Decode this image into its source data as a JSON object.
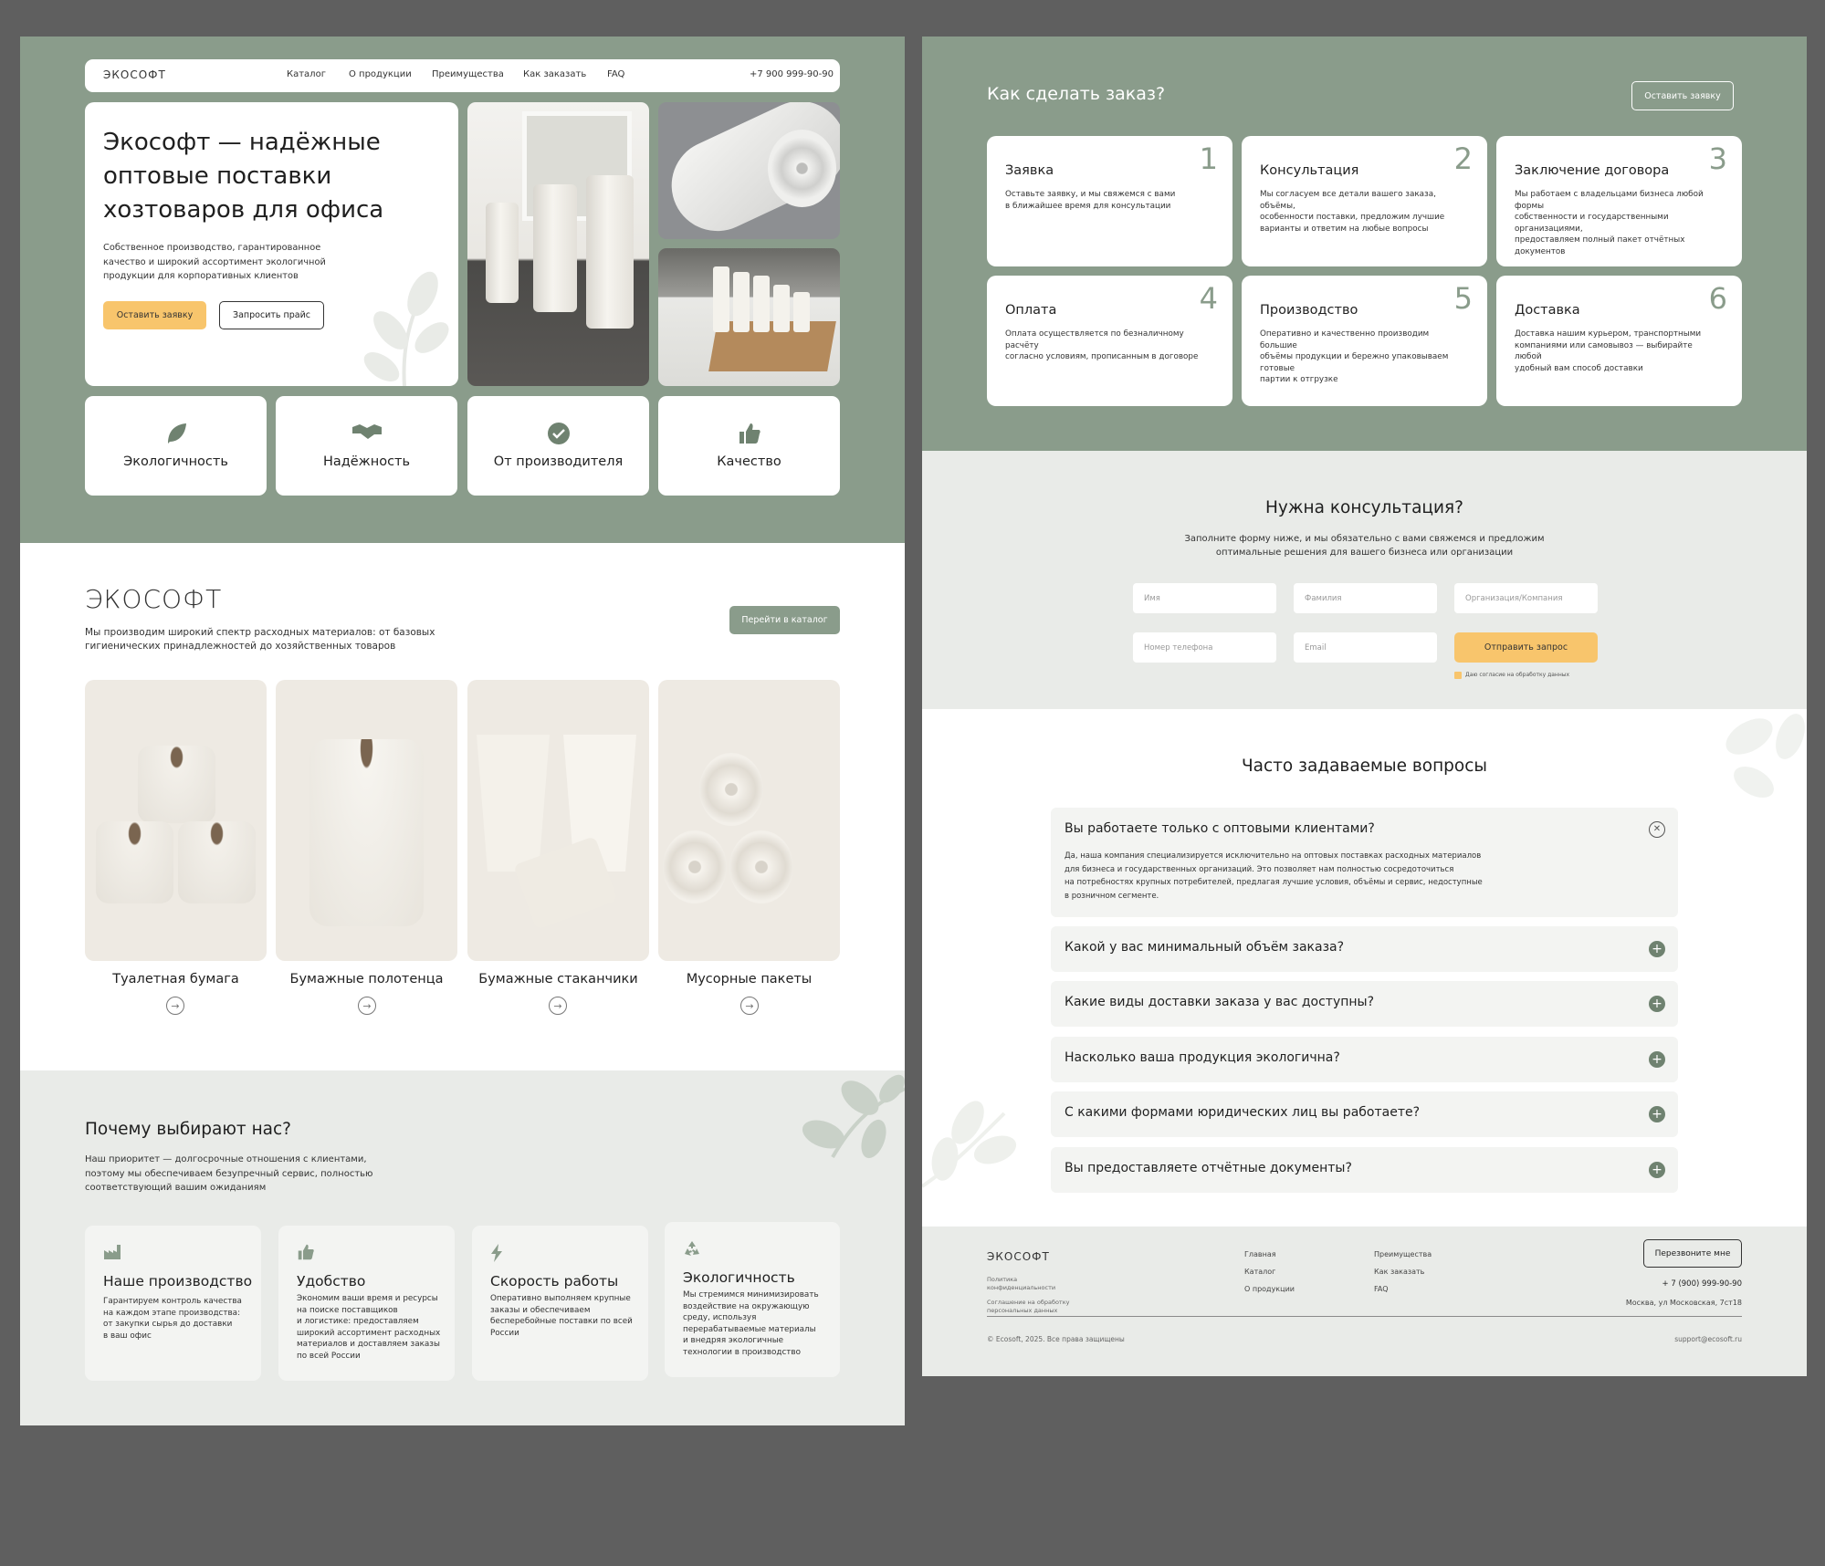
{
  "left": {
    "nav": {
      "logo": "ЭКОСОФТ",
      "links": [
        "Каталог",
        "О продукции",
        "Преимущества",
        "Как заказать",
        "FAQ"
      ],
      "phone": "+7 900 999-90-90"
    },
    "hero": {
      "title_line1": "Экософт — надёжные",
      "title_line2": "оптовые поставки",
      "title_line3": "хозтоваров для офиса",
      "desc_line1": "Собственное производство, гарантированное",
      "desc_line2": "качество и широкий ассортимент экологичной",
      "desc_line3": "продукции для корпоративных клиентов",
      "btn_primary": "Оставить заявку",
      "btn_secondary": "Запросить прайс"
    },
    "features": [
      "Экологичность",
      "Надёжность",
      "От производителя",
      "Качество"
    ],
    "catalog": {
      "logo": "ЭКОСОФТ",
      "desc_line1": "Мы производим широкий спектр расходных материалов: от базовых",
      "desc_line2": "гигиенических принадлежностей до хозяйственных товаров",
      "button": "Перейти в каталог",
      "products": [
        "Туалетная бумага",
        "Бумажные полотенца",
        "Бумажные стаканчики",
        "Мусорные пакеты"
      ]
    },
    "why": {
      "title": "Почему выбирают нас?",
      "desc_line1": "Наш приоритет — долгосрочные отношения с клиентами,",
      "desc_line2": "поэтому мы обеспечиваем безупречный сервис, полностью",
      "desc_line3": "соответствующий вашим ожиданиям",
      "cards": [
        {
          "title": "Наше производство",
          "lines": [
            "Гарантируем контроль качества",
            "на каждом этапе производства:",
            "от закупки сырья до доставки",
            "в ваш офис"
          ]
        },
        {
          "title": "Удобство",
          "lines": [
            "Экономим ваши время и ресурсы",
            "на поиске поставщиков",
            "и логистике: предоставляем",
            "широкий ассортимент расходных",
            "материалов и доставляем заказы",
            "по всей России"
          ]
        },
        {
          "title": "Скорость работы",
          "lines": [
            "Оперативно выполняем крупные",
            "заказы и обеспечиваем",
            "бесперебойные поставки по всей",
            "России"
          ]
        },
        {
          "title": "Экологичность",
          "lines": [
            "Мы стремимся минимизировать",
            "воздействие на окружающую",
            "среду, используя",
            "перерабатываемые материалы",
            "и внедряя экологичные",
            "технологии в производство"
          ]
        }
      ]
    }
  },
  "right": {
    "order": {
      "title": "Как сделать заказ?",
      "button": "Оставить заявку",
      "steps": [
        {
          "num": "1",
          "title": "Заявка",
          "lines": [
            "Оставьте заявку, и мы свяжемся с вами",
            "в ближайшее время для консультации"
          ]
        },
        {
          "num": "2",
          "title": "Консультация",
          "lines": [
            "Мы согласуем все детали вашего заказа, объёмы,",
            "особенности поставки, предложим лучшие",
            "варианты и ответим на любые вопросы"
          ]
        },
        {
          "num": "3",
          "title": "Заключение договора",
          "lines": [
            "Мы работаем с владельцами бизнеса любой формы",
            "собственности и государственными организациями,",
            "предоставляем полный пакет отчётных документов"
          ]
        },
        {
          "num": "4",
          "title": "Оплата",
          "lines": [
            "Оплата осуществляется по безналичному расчёту",
            "согласно условиям, прописанным в договоре"
          ]
        },
        {
          "num": "5",
          "title": "Производство",
          "lines": [
            "Оперативно и качественно производим большие",
            "объёмы продукции и бережно упаковываем готовые",
            "партии к отгрузке"
          ]
        },
        {
          "num": "6",
          "title": "Доставка",
          "lines": [
            "Доставка нашим курьером, транспортными",
            "компаниями или самовывоз — выбирайте любой",
            "удобный вам способ доставки"
          ]
        }
      ]
    },
    "consult": {
      "title": "Нужна консультация?",
      "desc_line1": "Заполните форму ниже, и мы обязательно с вами свяжемся и предложим",
      "desc_line2": "оптимальные решения для вашего бизнеса или организации",
      "ph_name": "Имя",
      "ph_surname": "Фамилия",
      "ph_org": "Организация/Компания",
      "ph_phone": "Номер телефона",
      "ph_email": "Email",
      "submit": "Отправить запрос",
      "consent": "Даю согласие на обработку данных"
    },
    "faq": {
      "title": "Часто задаваемые вопросы",
      "open_q": "Вы работаете только с оптовыми клиентами?",
      "open_a": [
        "Да, наша компания специализируется исключительно на оптовых поставках расходных материалов",
        "для бизнеса и государственных организаций. Это позволяет нам полностью сосредоточиться",
        "на потребностях крупных потребителей, предлагая лучшие условия, объёмы и сервис, недоступные",
        "в розничном сегменте."
      ],
      "items": [
        "Какой у вас минимальный объём заказа?",
        "Какие виды доставки заказа у вас доступны?",
        "Насколько ваша продукция экологична?",
        "С какими формами юридических лиц вы работаете?",
        "Вы предоставляете отчётные документы?"
      ]
    },
    "footer": {
      "logo": "ЭКОСОФТ",
      "policy1": "Политика",
      "policy2": "конфиденциальности",
      "agree1": "Соглашение на обработку",
      "agree2": "персональных данных",
      "col1": [
        "Главная",
        "Каталог",
        "О продукции"
      ],
      "col2": [
        "Преимущества",
        "Как заказать",
        "FAQ"
      ],
      "callback": "Перезвоните мне",
      "phone": "+ 7 (900) 999-90-90",
      "address": "Москва, ул Московская, 7ст18",
      "copyright": "© Ecosoft, 2025. Все права защищены",
      "email": "support@ecosoft.ru"
    }
  }
}
